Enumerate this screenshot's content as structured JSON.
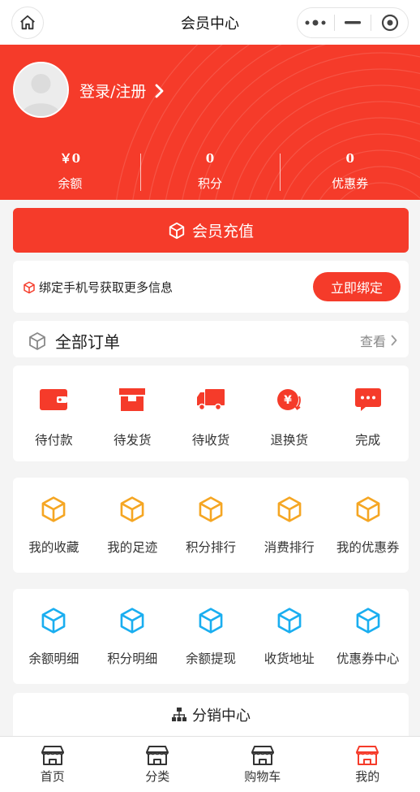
{
  "titlebar": {
    "title": "会员中心"
  },
  "header": {
    "login_label": "登录/注册",
    "stats": [
      {
        "value": "￥0",
        "label": "余额"
      },
      {
        "value": "0",
        "label": "积分"
      },
      {
        "value": "0",
        "label": "优惠券"
      }
    ]
  },
  "recharge": {
    "label": "会员充值"
  },
  "bind": {
    "text": "绑定手机号获取更多信息",
    "button": "立即绑定"
  },
  "orders": {
    "title": "全部订单",
    "view_all": "查看",
    "items": [
      {
        "label": "待付款",
        "icon": "wallet-icon"
      },
      {
        "label": "待发货",
        "icon": "box-icon"
      },
      {
        "label": "待收货",
        "icon": "truck-icon"
      },
      {
        "label": "退换货",
        "icon": "refund-icon"
      },
      {
        "label": "完成",
        "icon": "chat-icon"
      }
    ]
  },
  "menu1": {
    "color": "#f5a623",
    "items": [
      {
        "label": "我的收藏"
      },
      {
        "label": "我的足迹"
      },
      {
        "label": "积分排行"
      },
      {
        "label": "消费排行"
      },
      {
        "label": "我的优惠券"
      }
    ]
  },
  "menu2": {
    "color": "#1aaef0",
    "items": [
      {
        "label": "余额明细"
      },
      {
        "label": "积分明细"
      },
      {
        "label": "余额提现"
      },
      {
        "label": "收货地址"
      },
      {
        "label": "优惠券中心"
      }
    ]
  },
  "distribution": {
    "label": "分销中心"
  },
  "tabbar": {
    "active_color": "#f53b2a",
    "items": [
      {
        "label": "首页",
        "active": false
      },
      {
        "label": "分类",
        "active": false
      },
      {
        "label": "购物车",
        "active": false
      },
      {
        "label": "我的",
        "active": true
      }
    ]
  },
  "colors": {
    "brand": "#f53b2a",
    "background": "#f4f4f4"
  }
}
